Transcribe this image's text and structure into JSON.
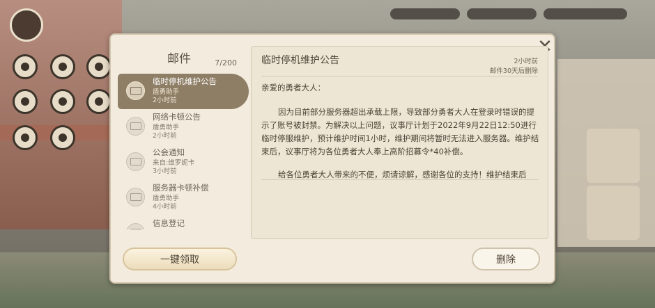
{
  "panel": {
    "sidebar_title": "邮件",
    "mail_count": "7/200",
    "close_icon": "close-icon",
    "collect_all_label": "一键领取",
    "delete_label": "删除"
  },
  "mails": [
    {
      "title": "临时停机维护公告",
      "sender": "盾勇助手",
      "time": "2小时前",
      "active": true
    },
    {
      "title": "网络卡顿公告",
      "sender": "盾勇助手",
      "time": "2小时前",
      "active": false
    },
    {
      "title": "公会通知",
      "sender": "来自:维罗妮卡",
      "time": "3小时前",
      "active": false
    },
    {
      "title": "服务器卡顿补偿",
      "sender": "盾勇助手",
      "time": "4小时前",
      "active": false
    },
    {
      "title": "信息登记",
      "sender": "",
      "time": "",
      "active": false
    }
  ],
  "content": {
    "title": "临时停机维护公告",
    "time": "2小时前",
    "expire": "邮件30天后删除",
    "greeting": "亲爱的勇者大人：",
    "paragraph1": "因为目前部分服务器超出承载上限，导致部分勇者大人在登录时错误的提示了账号被封禁。为解决以上问题，议事厅计划于2022年9月22日12:50进行临时停服维护，预计维护时间1小时，维护期间将暂时无法进入服务器。维护结束后，议事厅将为各位勇者大人奉上高阶招募令*40补偿。",
    "paragraph2": "给各位勇者大人带来的不便，烦请谅解，感谢各位的支持！维护结束后"
  }
}
